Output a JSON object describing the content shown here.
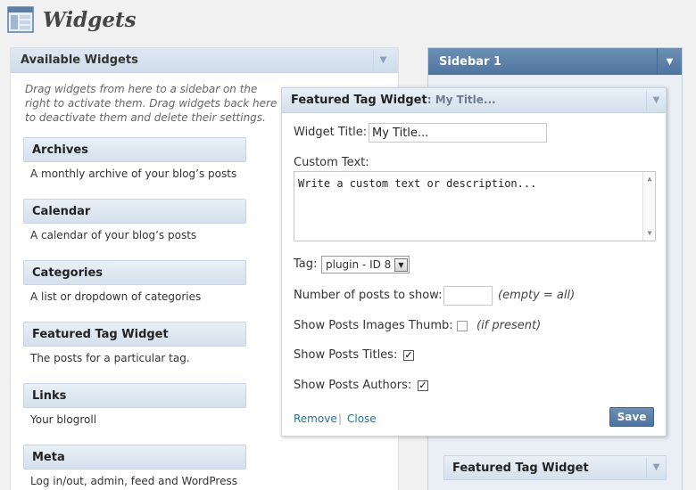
{
  "page": {
    "title": "Widgets",
    "icon": "widgets-icon"
  },
  "available": {
    "title": "Available Widgets",
    "description": "Drag widgets from here to a sidebar on the right to activate them. Drag widgets back here to deactivate them and delete their settings.",
    "widgets": [
      {
        "title": "Archives",
        "desc": "A monthly archive of your blog’s posts"
      },
      {
        "title": "Calendar",
        "desc": "A calendar of your blog’s posts"
      },
      {
        "title": "Categories",
        "desc": "A list or dropdown of categories"
      },
      {
        "title": "Featured Tag Widget",
        "desc": "The posts for a particular tag."
      },
      {
        "title": "Links",
        "desc": "Your blogroll"
      },
      {
        "title": "Meta",
        "desc": "Log in/out, admin, feed and WordPress"
      }
    ]
  },
  "sidebar": {
    "title": "Sidebar 1",
    "widgets": [
      {
        "title": "Featured Tag Widget"
      }
    ]
  },
  "dialog": {
    "title": "Featured Tag Widget",
    "subtitle": ": My Title...",
    "widget_title_label": "Widget Title:",
    "widget_title_value": "My Title...",
    "custom_text_label": "Custom Text:",
    "custom_text_value": "Write a custom text or description...",
    "tag_label": "Tag:",
    "tag_value": "plugin - ID 8",
    "num_posts_label": "Number of posts to show:",
    "num_posts_value": "",
    "num_posts_hint": "(empty = all)",
    "thumb_label": "Show Posts Images Thumb:",
    "thumb_checked": false,
    "thumb_hint": "(if present)",
    "titles_label": "Show Posts Titles:",
    "titles_checked": true,
    "authors_label": "Show Posts Authors:",
    "authors_checked": true,
    "remove_label": "Remove",
    "separator": "|",
    "close_label": "Close",
    "save_label": "Save"
  },
  "colors": {
    "accent": "#4f74a0",
    "link": "#21759b",
    "header_bg": "#dfe9f4"
  }
}
